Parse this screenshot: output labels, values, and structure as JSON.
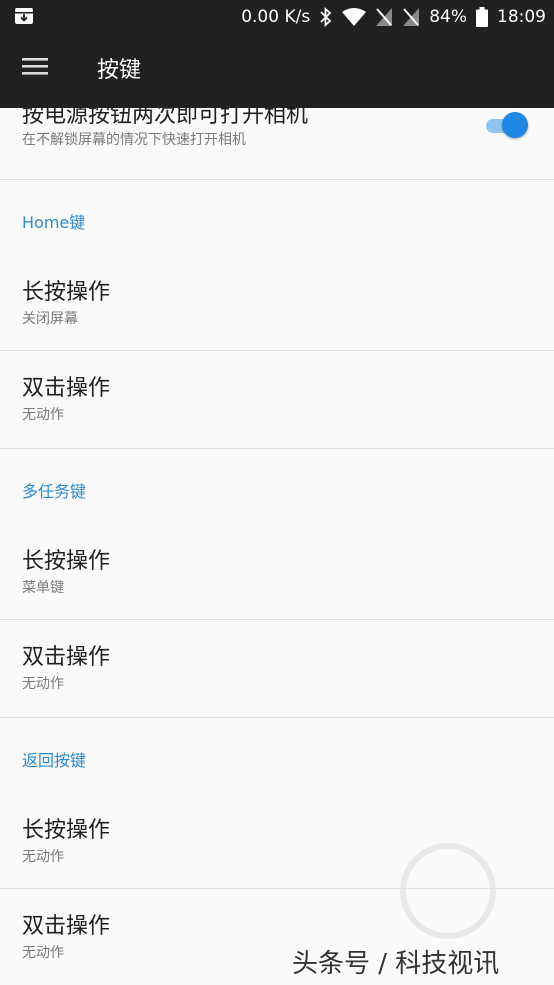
{
  "status_bar": {
    "speed": "0.00 K/s",
    "battery": "84%",
    "time": "18:09"
  },
  "toolbar": {
    "title": "按键"
  },
  "top_item": {
    "title": "按电源按钮两次即可打开相机",
    "subtitle": "在不解锁屏幕的情况下快速打开相机",
    "toggle_on": true
  },
  "sections": [
    {
      "header": "Home键",
      "items": [
        {
          "title": "长按操作",
          "value": "关闭屏幕"
        },
        {
          "title": "双击操作",
          "value": "无动作"
        }
      ]
    },
    {
      "header": "多任务键",
      "items": [
        {
          "title": "长按操作",
          "value": "菜单键"
        },
        {
          "title": "双击操作",
          "value": "无动作"
        }
      ]
    },
    {
      "header": "返回按键",
      "items": [
        {
          "title": "长按操作",
          "value": "无动作"
        },
        {
          "title": "双击操作",
          "value": "无动作"
        }
      ]
    }
  ],
  "watermark": "头条号 / 科技视讯",
  "colors": {
    "accent": "#1f88e5",
    "section_header": "#2a8bd0",
    "toolbar_bg": "#212121"
  }
}
